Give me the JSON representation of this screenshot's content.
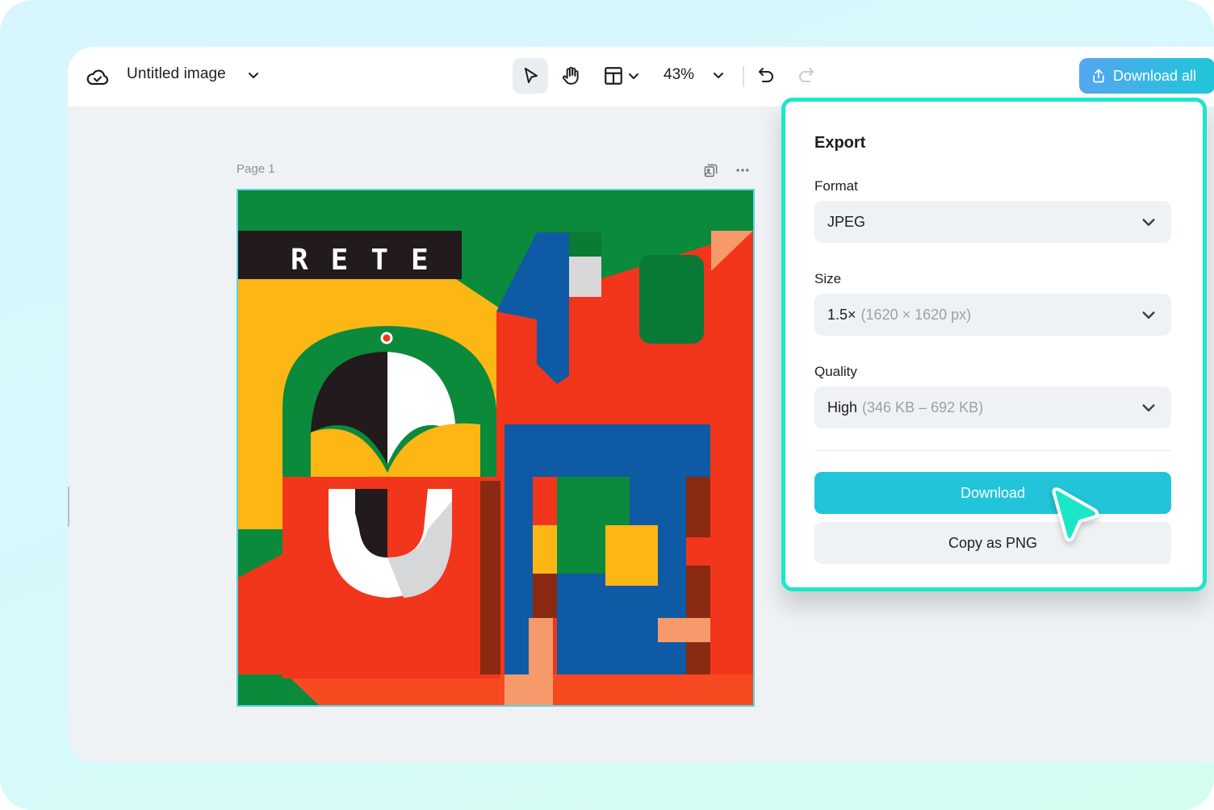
{
  "header": {
    "doc_title": "Untitled image",
    "zoom_level": "43%",
    "download_all_label": "Download all"
  },
  "icons": {
    "cloud": "cloud-check-icon",
    "title_chevron": "chevron-down-icon",
    "select_tool": "pointer-arrow-icon",
    "hand_tool": "hand-icon",
    "layout": "layout-panel-icon",
    "undo": "undo-icon",
    "redo": "redo-icon",
    "upload": "share-upload-icon",
    "duplicate_page": "duplicate-image-icon",
    "more": "more-horizontal-icon"
  },
  "page": {
    "label": "Page 1",
    "artwork_text": "RETE"
  },
  "export_panel": {
    "title": "Export",
    "format": {
      "label": "Format",
      "value": "JPEG"
    },
    "size": {
      "label": "Size",
      "value": "1.5×",
      "detail": "(1620 × 1620 px)"
    },
    "quality": {
      "label": "Quality",
      "value": "High",
      "detail": "(346 KB – 692 KB)"
    },
    "download_label": "Download",
    "copy_label": "Copy as PNG"
  },
  "colors": {
    "accent_teal": "#1ee6c8",
    "download_button": "#21c4d8",
    "download_all_gradient_start": "#56a6ef",
    "download_all_gradient_end": "#1ec6d9"
  }
}
